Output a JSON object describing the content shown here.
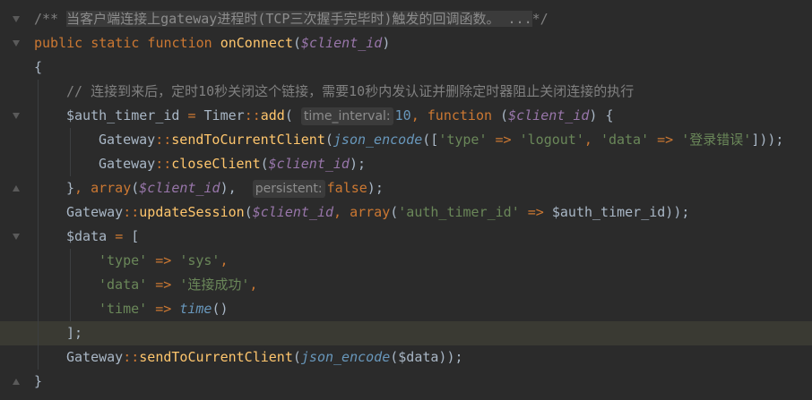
{
  "editor": {
    "lines": [
      {
        "segments": [
          {
            "cls": "cm",
            "text": "/** "
          },
          {
            "cls": "cm fold-hl",
            "text": "当客户端连接上gateway进程时(TCP三次握手完毕时)触发的回调函数。 ..."
          },
          {
            "cls": "cm",
            "text": "*/"
          }
        ],
        "indent": 0
      },
      {
        "segments": [
          {
            "cls": "kw",
            "text": "public static function "
          },
          {
            "cls": "fn",
            "text": "onConnect"
          },
          {
            "cls": "plain",
            "text": "("
          },
          {
            "cls": "var",
            "text": "$client_id"
          },
          {
            "cls": "plain",
            "text": ")"
          }
        ],
        "indent": 0
      },
      {
        "segments": [
          {
            "cls": "plain",
            "text": "{"
          }
        ],
        "indent": 0
      },
      {
        "segments": [
          {
            "cls": "cm",
            "text": "// 连接到来后，定时10秒关闭这个链接，需要10秒内发认证并删除定时器阻止关闭连接的执行"
          }
        ],
        "indent": 1
      },
      {
        "segments": [
          {
            "cls": "plain",
            "text": "$auth_timer_id "
          },
          {
            "cls": "op",
            "text": "= "
          },
          {
            "cls": "plain",
            "text": "Timer"
          },
          {
            "cls": "dcolon",
            "text": "::"
          },
          {
            "cls": "fn",
            "text": "add"
          },
          {
            "cls": "plain",
            "text": "( "
          },
          {
            "cls": "hint",
            "text": "time_interval:"
          },
          {
            "cls": "num",
            "text": "10"
          },
          {
            "cls": "kw",
            "text": ", function "
          },
          {
            "cls": "plain",
            "text": "("
          },
          {
            "cls": "var",
            "text": "$client_id"
          },
          {
            "cls": "plain",
            "text": ") {"
          }
        ],
        "indent": 1
      },
      {
        "segments": [
          {
            "cls": "plain",
            "text": "Gateway"
          },
          {
            "cls": "dcolon",
            "text": "::"
          },
          {
            "cls": "fn",
            "text": "sendToCurrentClient"
          },
          {
            "cls": "plain",
            "text": "("
          },
          {
            "cls": "itfn",
            "text": "json_encode"
          },
          {
            "cls": "plain",
            "text": "(["
          },
          {
            "cls": "str",
            "text": "'type'"
          },
          {
            "cls": "op",
            "text": " => "
          },
          {
            "cls": "str",
            "text": "'logout'"
          },
          {
            "cls": "kw",
            "text": ", "
          },
          {
            "cls": "str",
            "text": "'data'"
          },
          {
            "cls": "op",
            "text": " => "
          },
          {
            "cls": "str",
            "text": "'登录错误'"
          },
          {
            "cls": "plain",
            "text": "]));"
          }
        ],
        "indent": 2
      },
      {
        "segments": [
          {
            "cls": "plain",
            "text": "Gateway"
          },
          {
            "cls": "dcolon",
            "text": "::"
          },
          {
            "cls": "fn",
            "text": "closeClient"
          },
          {
            "cls": "plain",
            "text": "("
          },
          {
            "cls": "var",
            "text": "$client_id"
          },
          {
            "cls": "plain",
            "text": ");"
          }
        ],
        "indent": 2
      },
      {
        "segments": [
          {
            "cls": "plain",
            "text": "}"
          },
          {
            "cls": "kw",
            "text": ", array"
          },
          {
            "cls": "plain",
            "text": "("
          },
          {
            "cls": "var",
            "text": "$client_id"
          },
          {
            "cls": "plain",
            "text": "),  "
          },
          {
            "cls": "hint",
            "text": "persistent:"
          },
          {
            "cls": "kw",
            "text": "false"
          },
          {
            "cls": "plain",
            "text": ");"
          }
        ],
        "indent": 1
      },
      {
        "segments": [
          {
            "cls": "plain",
            "text": "Gateway"
          },
          {
            "cls": "dcolon",
            "text": "::"
          },
          {
            "cls": "fn",
            "text": "updateSession"
          },
          {
            "cls": "plain",
            "text": "("
          },
          {
            "cls": "var",
            "text": "$client_id"
          },
          {
            "cls": "kw",
            "text": ", array"
          },
          {
            "cls": "plain",
            "text": "("
          },
          {
            "cls": "str",
            "text": "'auth_timer_id'"
          },
          {
            "cls": "op",
            "text": " => "
          },
          {
            "cls": "plain",
            "text": "$auth_timer_id));"
          }
        ],
        "indent": 1
      },
      {
        "segments": [
          {
            "cls": "plain",
            "text": "$data "
          },
          {
            "cls": "op",
            "text": "= "
          },
          {
            "cls": "plain",
            "text": "["
          }
        ],
        "indent": 1
      },
      {
        "segments": [
          {
            "cls": "str",
            "text": "'type'"
          },
          {
            "cls": "op",
            "text": " => "
          },
          {
            "cls": "str",
            "text": "'sys'"
          },
          {
            "cls": "kw",
            "text": ","
          }
        ],
        "indent": 2
      },
      {
        "segments": [
          {
            "cls": "str",
            "text": "'data'"
          },
          {
            "cls": "op",
            "text": " => "
          },
          {
            "cls": "str",
            "text": "'连接成功'"
          },
          {
            "cls": "kw",
            "text": ","
          }
        ],
        "indent": 2
      },
      {
        "segments": [
          {
            "cls": "str",
            "text": "'time'"
          },
          {
            "cls": "op",
            "text": " => "
          },
          {
            "cls": "itfn",
            "text": "time"
          },
          {
            "cls": "plain",
            "text": "()"
          }
        ],
        "indent": 2
      },
      {
        "segments": [
          {
            "cls": "plain",
            "text": "];"
          }
        ],
        "indent": 1,
        "highlight": true
      },
      {
        "segments": [
          {
            "cls": "plain",
            "text": "Gateway"
          },
          {
            "cls": "dcolon",
            "text": "::"
          },
          {
            "cls": "fn",
            "text": "sendToCurrentClient"
          },
          {
            "cls": "plain",
            "text": "("
          },
          {
            "cls": "itfn",
            "text": "json_encode"
          },
          {
            "cls": "plain",
            "text": "($data));"
          }
        ],
        "indent": 1
      },
      {
        "segments": [
          {
            "cls": "plain",
            "text": "}"
          }
        ],
        "indent": 0
      }
    ]
  },
  "colors": {
    "background": "#2b2b2b",
    "keyword": "#cc7832",
    "function": "#ffc66d",
    "variable": "#9876aa",
    "string": "#6a8759",
    "comment": "#808080",
    "number": "#6897bb",
    "text": "#a9b7c6"
  }
}
